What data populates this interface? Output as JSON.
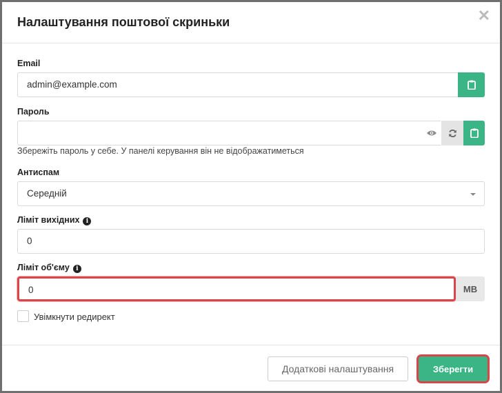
{
  "modal": {
    "title": "Налаштування поштової скриньки",
    "close_symbol": "✕"
  },
  "form": {
    "email": {
      "label": "Email",
      "value": "admin@example.com"
    },
    "password": {
      "label": "Пароль",
      "value": "",
      "hint": "Збережіть пароль у себе. У панелі керування він не відображатиметься"
    },
    "antispam": {
      "label": "Антиспам",
      "selected": "Середній"
    },
    "outgoing_limit": {
      "label": "Ліміт вихідних",
      "value": "0"
    },
    "volume_limit": {
      "label": "Ліміт об'єму",
      "value": "0",
      "unit": "MB"
    },
    "redirect": {
      "label": "Увімкнути редирект",
      "checked": false
    }
  },
  "footer": {
    "advanced_label": "Додаткові налаштування",
    "save_label": "Зберегти"
  },
  "colors": {
    "accent": "#3bb486",
    "highlight": "#d8454a"
  },
  "icons": {
    "clipboard": "clipboard-icon",
    "eye": "eye-icon",
    "refresh": "refresh-icon",
    "info": "info-icon",
    "close": "close-icon"
  }
}
